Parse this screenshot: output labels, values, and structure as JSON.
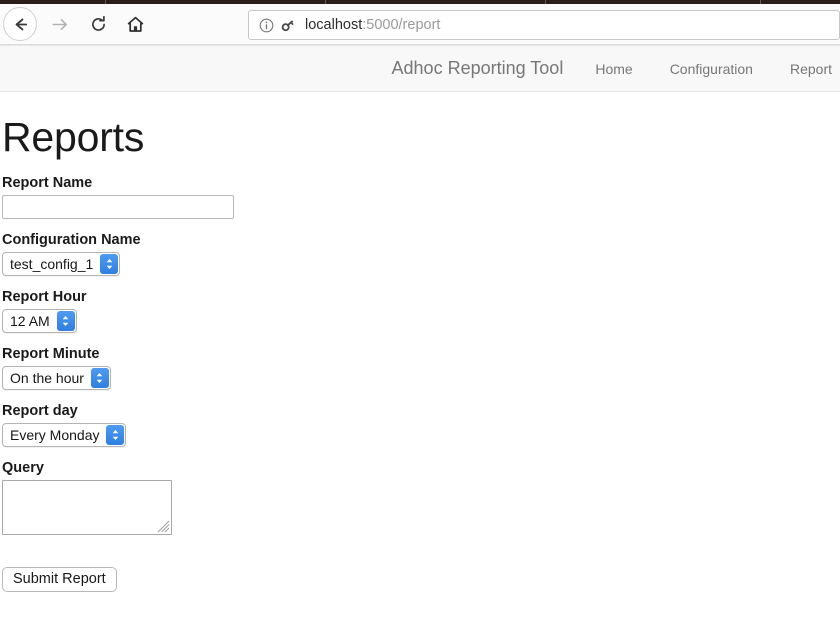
{
  "browser": {
    "back_icon": "back-arrow-icon",
    "forward_icon": "forward-arrow-icon",
    "reload_icon": "reload-icon",
    "home_icon": "home-icon",
    "info_icon": "info-circle-icon",
    "key_icon": "key-icon",
    "url_host": "localhost",
    "url_path": ":5000/report"
  },
  "navbar": {
    "brand": "Adhoc Reporting Tool",
    "links": [
      {
        "label": "Home"
      },
      {
        "label": "Configuration"
      },
      {
        "label": "Report"
      }
    ]
  },
  "page": {
    "title": "Reports",
    "fields": {
      "report_name": {
        "label": "Report Name",
        "value": "",
        "placeholder": ""
      },
      "configuration_name": {
        "label": "Configuration Name",
        "value": "test_config_1"
      },
      "report_hour": {
        "label": "Report Hour",
        "value": "12 AM"
      },
      "report_minute": {
        "label": "Report Minute",
        "value": "On the hour"
      },
      "report_day": {
        "label": "Report day",
        "value": "Every Monday"
      },
      "query": {
        "label": "Query",
        "value": "",
        "placeholder": ""
      }
    },
    "submit_label": "Submit Report"
  },
  "colors": {
    "select_accent": "#3f86e6",
    "navbar_bg": "#f8f8f8",
    "navbar_text": "#777777",
    "tab_strip": "#2b1d18"
  }
}
